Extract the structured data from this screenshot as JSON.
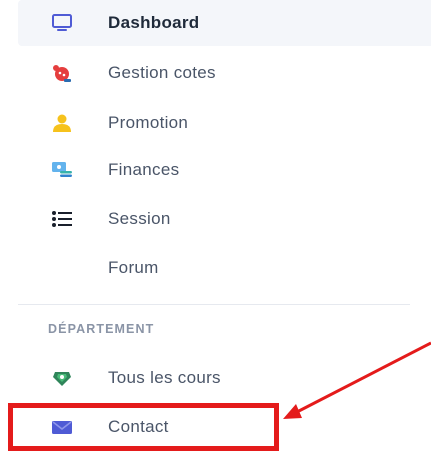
{
  "sidebar": {
    "items": [
      {
        "label": "Dashboard",
        "icon": "monitor-icon"
      },
      {
        "label": "Gestion cotes",
        "icon": "bug-icon"
      },
      {
        "label": "Promotion",
        "icon": "user-icon"
      },
      {
        "label": "Finances",
        "icon": "money-icon"
      },
      {
        "label": "Session",
        "icon": "list-icon"
      },
      {
        "label": "Forum",
        "icon": ""
      }
    ],
    "section_header": "DÉPARTEMENT",
    "section_items": [
      {
        "label": "Tous les cours",
        "icon": "gem-icon"
      },
      {
        "label": "Contact",
        "icon": "envelope-icon"
      }
    ]
  },
  "colors": {
    "accent": "#4f5bd5",
    "annotation_red": "#e41b1b"
  }
}
